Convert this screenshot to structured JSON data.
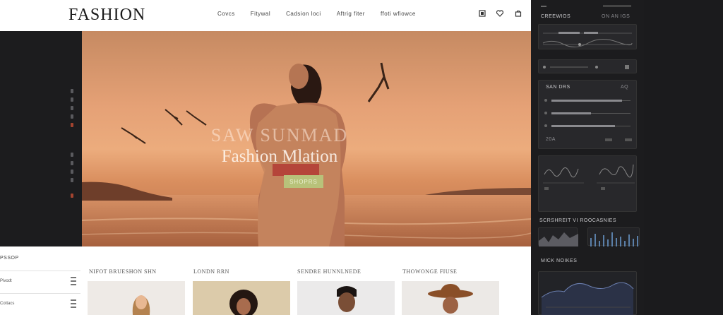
{
  "header": {
    "logo": "FASHION",
    "nav": [
      "Covcs",
      "Fitywal",
      "Cadsion loci",
      "Aftrig  fiter",
      "ffoti wfiowce"
    ]
  },
  "hero": {
    "subtitle": "SAW SUNMAD",
    "title": "Fashion Mlation",
    "cta": "SHOPRS"
  },
  "filters": {
    "heading": "PSSOP",
    "rows": [
      "Pivodt",
      "Cottacs"
    ]
  },
  "cards": [
    {
      "label": "NIFOT BRUESHON SHN"
    },
    {
      "label": "LONDN RRN"
    },
    {
      "label": "SENDRE HUNNLNEDE"
    },
    {
      "label": "THOWONGE FIUSE"
    }
  ],
  "dashboard": {
    "section1_title": "CREEWIOS",
    "section1_right": "ON AN IGS",
    "section2_title": "SAN DRS",
    "section2_right": "AQ",
    "section2_foot": "20A",
    "section3_title": "SCRSHREIT VI ROOCASNIES",
    "section4_title": "MICK NOIKES"
  },
  "colors": {
    "accent_red": "#a2432f",
    "cta_green": "#b8c27a",
    "chart_blue": "#5a7fa8"
  },
  "icons": [
    "user-icon",
    "heart-icon",
    "bag-icon"
  ]
}
